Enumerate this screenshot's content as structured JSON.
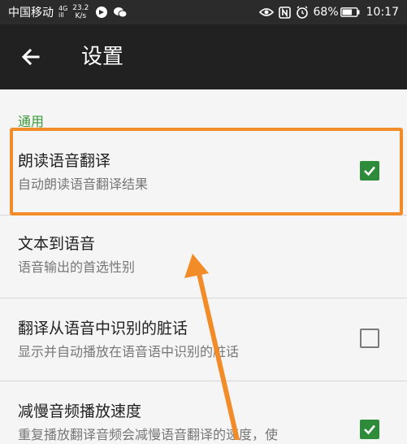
{
  "status_bar": {
    "carrier": "中国移动",
    "signal_type": "4G",
    "signal_bars": "ill",
    "speed_value": "23.2",
    "speed_unit": "K/s",
    "battery": "68%",
    "time": "10:17"
  },
  "toolbar": {
    "title": "设置"
  },
  "section": {
    "header": "通用"
  },
  "preferences": [
    {
      "title": "朗读语音翻译",
      "summary": "自动朗读语音翻译结果",
      "has_checkbox": true,
      "checked": true
    },
    {
      "title": "文本到语音",
      "summary": "语音输出的首选性别",
      "has_checkbox": false
    },
    {
      "title": "翻译从语音中识别的脏话",
      "summary": "显示并自动播放在语音语中识别的脏话",
      "has_checkbox": true,
      "checked": false
    },
    {
      "title": "减慢音频播放速度",
      "summary": "重复播放翻译音频会减慢语音翻译的速度，使",
      "has_checkbox": true,
      "checked": true
    }
  ],
  "colors": {
    "accent": "#3a9a3a",
    "checkbox": "#2e8b3a",
    "highlight": "#f28c28",
    "toolbar": "#212121"
  },
  "icons": [
    "back-arrow-icon",
    "eye-icon",
    "nfc-icon",
    "alarm-icon",
    "battery-icon"
  ]
}
